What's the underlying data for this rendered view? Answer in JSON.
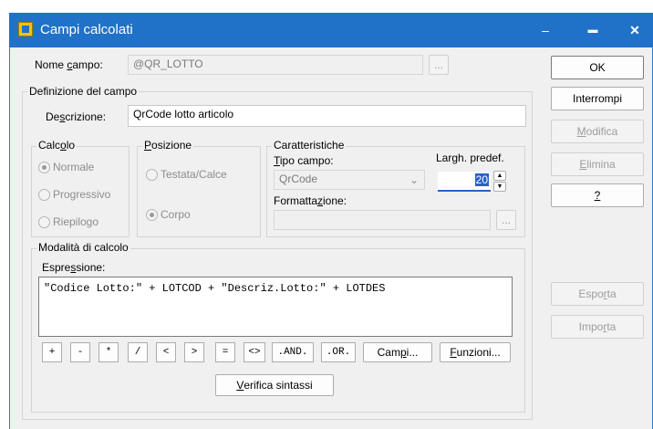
{
  "window": {
    "title": "Campi calcolati",
    "min_glyph": "–",
    "max_glyph": "▬",
    "close_glyph": "✕"
  },
  "nome_campo": {
    "label": "Nome campo:",
    "value": "@QR_LOTTO",
    "browse": "..."
  },
  "definizione": {
    "caption": "Definizione del campo",
    "descrizione_label": "Descrizione:",
    "descrizione_value": "QrCode lotto articolo"
  },
  "calcolo": {
    "caption": "Calcolo",
    "options": [
      "Normale",
      "Progressivo",
      "Riepilogo"
    ],
    "selected": "Normale"
  },
  "posizione": {
    "caption": "Posizione",
    "options": [
      "Testata/Calce",
      "Corpo"
    ],
    "selected": "Corpo"
  },
  "caratteristiche": {
    "caption": "Caratteristiche",
    "tipo_label": "Tipo campo:",
    "tipo_value": "QrCode",
    "largh_label": "Largh. predef.",
    "largh_value": "20",
    "format_label": "Formattazione:",
    "format_value": "",
    "format_browse": "..."
  },
  "modalita": {
    "caption": "Modalità di calcolo",
    "espressione_label": "Espressione:",
    "espressione_value": "\"Codice Lotto:\" + LOTCOD + \"Descriz.Lotto:\" + LOTDES",
    "operators": [
      "+",
      "-",
      "*",
      "/",
      "<",
      ">",
      "=",
      "<>",
      ".AND.",
      ".OR."
    ],
    "campi": "Campi...",
    "funzioni": "Funzioni...",
    "verifica": "Verifica sintassi"
  },
  "buttons": {
    "ok": "OK",
    "interrompi": "Interrompi",
    "modifica": "Modifica",
    "elimina": "Elimina",
    "help": "?",
    "esporta": "Esporta",
    "importa": "Importa"
  }
}
